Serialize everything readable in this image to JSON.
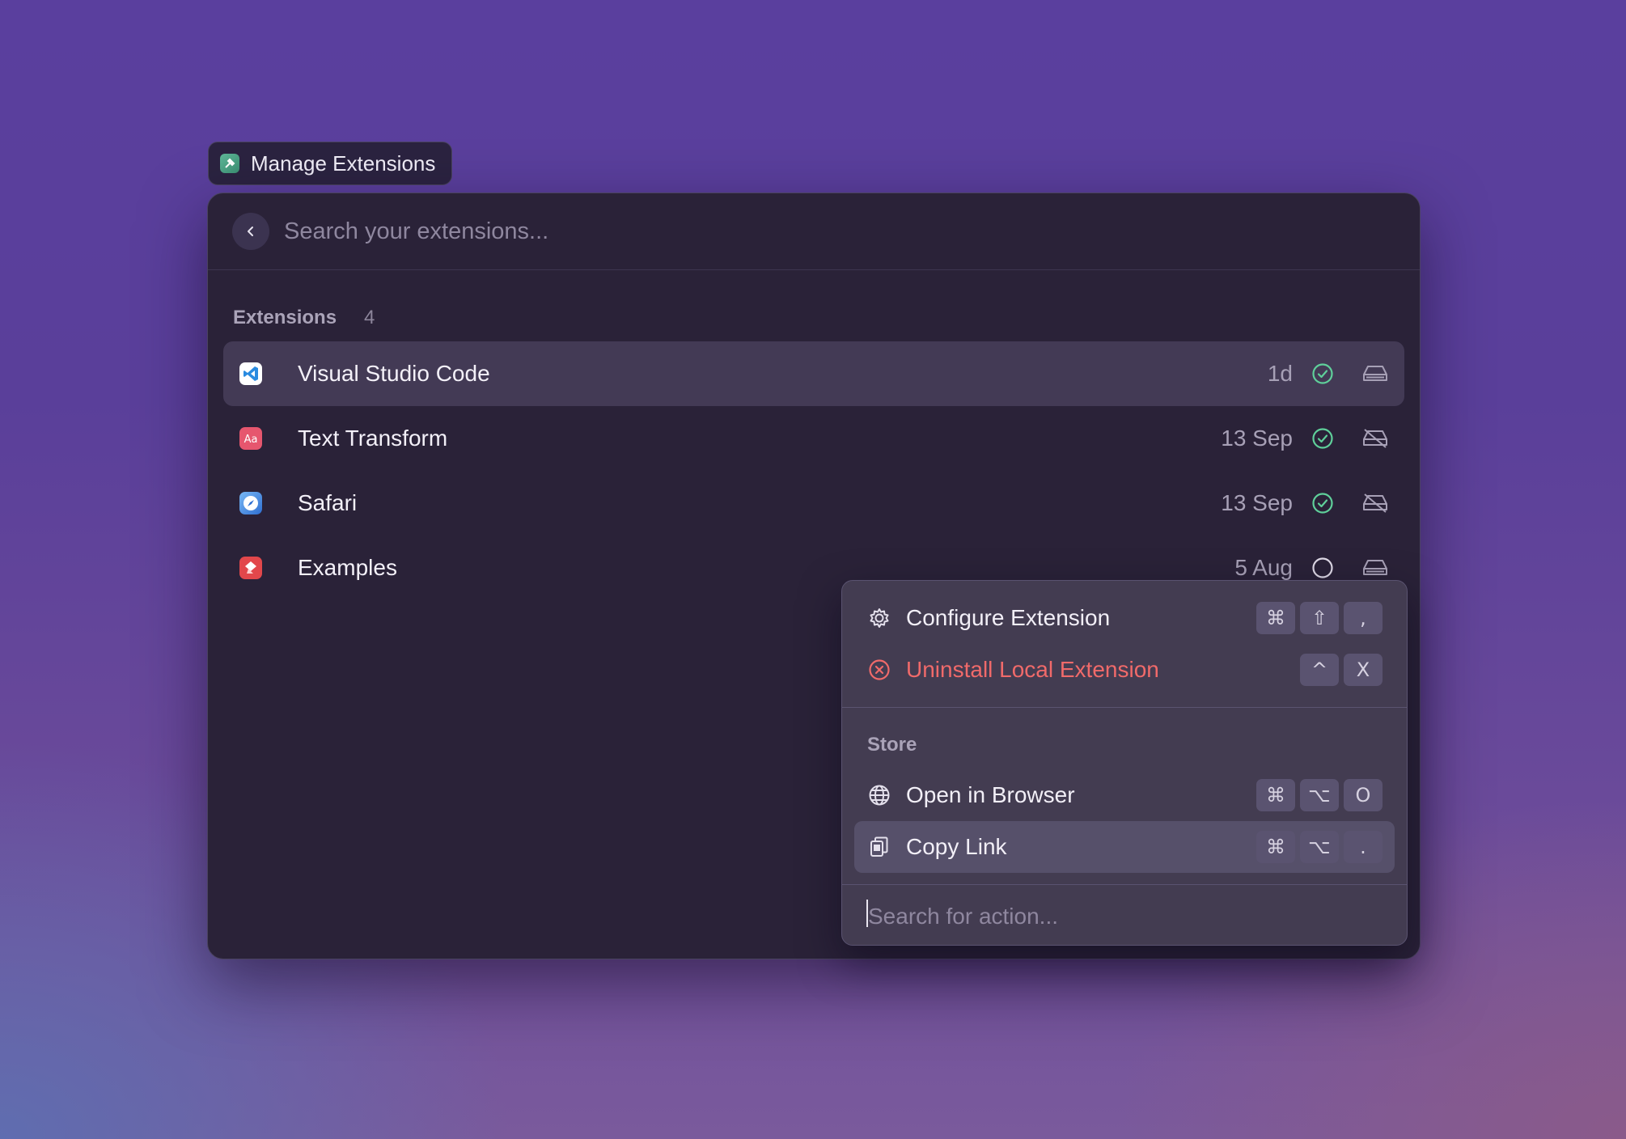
{
  "tab": {
    "title": "Manage Extensions",
    "icon": "hammer-icon"
  },
  "search": {
    "placeholder": "Search your extensions..."
  },
  "section": {
    "title": "Extensions",
    "count": "4"
  },
  "extensions": [
    {
      "name": "Visual Studio Code",
      "date": "1d",
      "enabled": true,
      "icon": "vscode-icon",
      "storage": "drive-icon",
      "selected": true
    },
    {
      "name": "Text Transform",
      "date": "13 Sep",
      "enabled": true,
      "icon": "text-transform-icon",
      "storage": "drive-off-icon",
      "selected": false
    },
    {
      "name": "Safari",
      "date": "13 Sep",
      "enabled": true,
      "icon": "safari-icon",
      "storage": "drive-off-icon",
      "selected": false
    },
    {
      "name": "Examples",
      "date": "5 Aug",
      "enabled": false,
      "icon": "examples-icon",
      "storage": "drive-icon",
      "selected": false
    }
  ],
  "action_panel": {
    "primary": [
      {
        "label": "Configure Extension",
        "icon": "gear-icon",
        "keys": [
          "⌘",
          "⇧",
          ","
        ]
      },
      {
        "label": "Uninstall Local Extension",
        "icon": "x-circle-icon",
        "keys": [
          "^",
          "X"
        ],
        "danger": true
      }
    ],
    "store_title": "Store",
    "store": [
      {
        "label": "Open in Browser",
        "icon": "globe-icon",
        "keys": [
          "⌘",
          "⌥",
          "O"
        ]
      },
      {
        "label": "Copy Link",
        "icon": "copy-icon",
        "keys": [
          "⌘",
          "⌥",
          "."
        ],
        "selected": true
      }
    ],
    "search_placeholder": "Search for action..."
  },
  "colors": {
    "accent_green": "#5fcf9a",
    "danger": "#f06a6a"
  }
}
